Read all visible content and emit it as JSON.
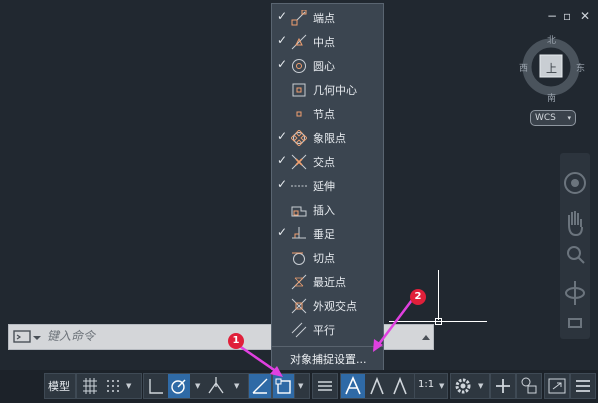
{
  "window_controls": [
    "−",
    "▫",
    "✕"
  ],
  "viewcube": {
    "face": "上",
    "north": "北",
    "south": "南",
    "east": "东",
    "west": "西"
  },
  "wcs": {
    "label": "WCS",
    "caret": "▾"
  },
  "command_line": {
    "placeholder": "键入命令"
  },
  "osnap_menu": {
    "items": [
      {
        "label": "端点",
        "checked": true,
        "icon": "endpoint-icon"
      },
      {
        "label": "中点",
        "checked": true,
        "icon": "midpoint-icon"
      },
      {
        "label": "圆心",
        "checked": true,
        "icon": "center-icon"
      },
      {
        "label": "几何中心",
        "checked": false,
        "icon": "geometric-center-icon"
      },
      {
        "label": "节点",
        "checked": false,
        "icon": "node-icon"
      },
      {
        "label": "象限点",
        "checked": true,
        "icon": "quadrant-icon"
      },
      {
        "label": "交点",
        "checked": true,
        "icon": "intersection-icon"
      },
      {
        "label": "延伸",
        "checked": true,
        "icon": "extension-icon"
      },
      {
        "label": "插入",
        "checked": false,
        "icon": "insertion-icon"
      },
      {
        "label": "垂足",
        "checked": true,
        "icon": "perpendicular-icon"
      },
      {
        "label": "切点",
        "checked": false,
        "icon": "tangent-icon"
      },
      {
        "label": "最近点",
        "checked": false,
        "icon": "nearest-icon"
      },
      {
        "label": "外观交点",
        "checked": false,
        "icon": "apparent-intersection-icon"
      },
      {
        "label": "平行",
        "checked": false,
        "icon": "parallel-icon"
      }
    ],
    "check_glyph": "✓",
    "settings_label": "对象捕捉设置..."
  },
  "status_bar": {
    "model_label": "模型",
    "scale_label": "1:1"
  },
  "annotations": {
    "badge1": "1",
    "badge2": "2"
  },
  "colors": {
    "accent": "#2f6aa6",
    "menu_bg": "#3b4550",
    "icon_orange": "#f0a070",
    "badge": "#e0203a",
    "arrow": "#e040e0"
  }
}
